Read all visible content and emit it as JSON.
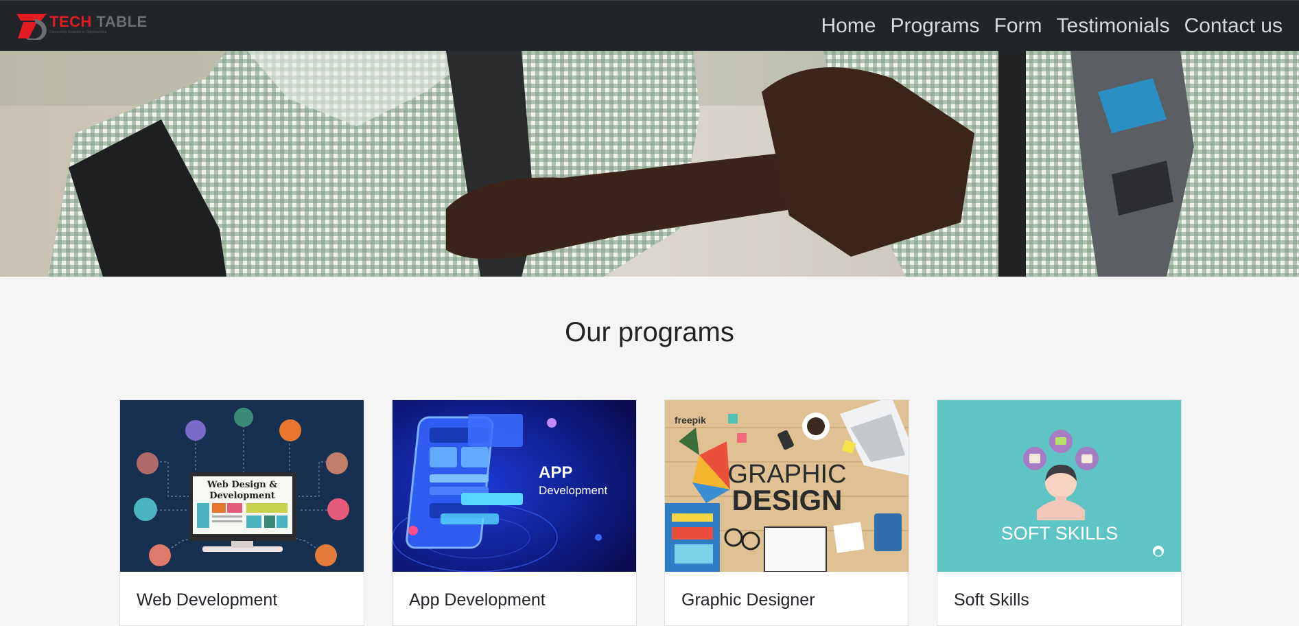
{
  "brand": {
    "name_part1": "Tech",
    "name_part2": "Table",
    "tagline": "Connecting Students to Opportunities",
    "logo_icon": "tech-table-logo",
    "accent_color": "#e31b23"
  },
  "nav": {
    "items": [
      {
        "label": "Home"
      },
      {
        "label": "Programs"
      },
      {
        "label": "Form"
      },
      {
        "label": "Testimonials"
      },
      {
        "label": "Contact us"
      }
    ]
  },
  "hero": {
    "image": "students-fist-bump-photo"
  },
  "programs": {
    "title": "Our programs",
    "cards": [
      {
        "title": "Web Development",
        "image_text_line1": "Web Design &",
        "image_text_line2": "Development"
      },
      {
        "title": "App Development",
        "image_text_line1": "APP",
        "image_text_line2": "Development"
      },
      {
        "title": "Graphic Designer",
        "image_text_line1": "GRAPHIC",
        "image_text_line2": "DESIGN",
        "image_brand": "freepik"
      },
      {
        "title": "Soft Skills",
        "image_text_line1": "SOFT SKILLS"
      }
    ]
  }
}
